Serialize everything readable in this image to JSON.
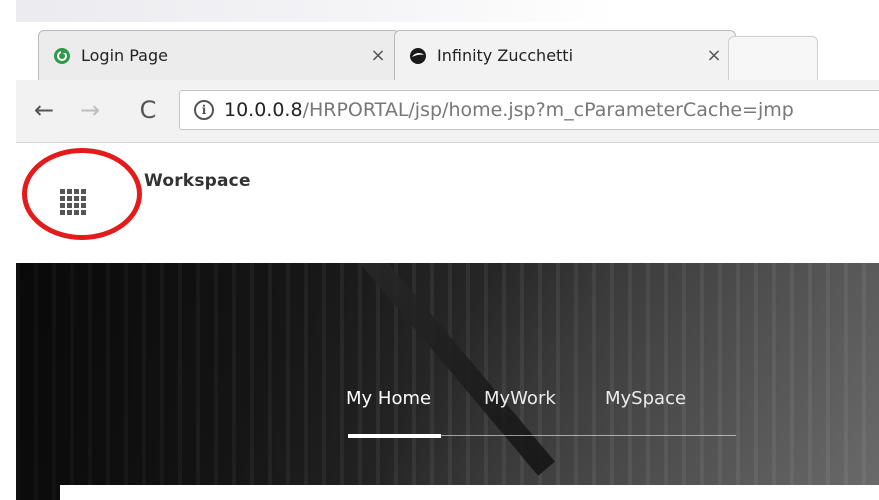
{
  "browser": {
    "tabs": [
      {
        "title": "Login Page",
        "icon": "login-page-favicon",
        "close": "×",
        "active": false
      },
      {
        "title": "Infinity Zucchetti",
        "icon": "infinity-zucchetti-favicon",
        "close": "×",
        "active": true
      }
    ],
    "new_tab_icon": "new-tab-icon",
    "nav": {
      "back": "←",
      "forward": "→",
      "reload": "C"
    },
    "address": {
      "info_icon": "i",
      "host": "10.0.0.8",
      "path": "/HRPORTAL/jsp/home.jsp?m_cParameterCache=jmp"
    }
  },
  "app": {
    "apps_icon": "apps-grid-icon",
    "title": "Workspace",
    "highlight_color": "#e41b1b"
  },
  "hero": {
    "tabs": [
      {
        "label": "My Home",
        "active": true
      },
      {
        "label": "MyWork",
        "active": false
      },
      {
        "label": "MySpace",
        "active": false
      }
    ]
  },
  "colors": {
    "accent_underline": "#ffffff",
    "hero_dark": "#141414"
  }
}
